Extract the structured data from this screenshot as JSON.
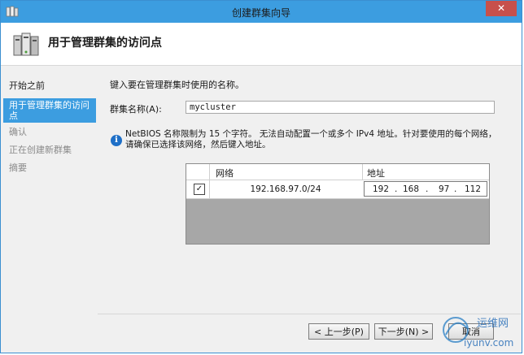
{
  "window": {
    "title": "创建群集向导",
    "close_glyph": "✕"
  },
  "header": {
    "title": "用于管理群集的访问点"
  },
  "sidebar": {
    "items": [
      {
        "label": "开始之前",
        "state": "normal"
      },
      {
        "label": "用于管理群集的访问点",
        "state": "active"
      },
      {
        "label": "确认",
        "state": "muted"
      },
      {
        "label": "正在创建新群集",
        "state": "muted"
      },
      {
        "label": "摘要",
        "state": "muted"
      }
    ]
  },
  "form": {
    "prompt": "键入要在管理群集时使用的名称。",
    "name_label": "群集名称(A):",
    "name_value": "mycluster"
  },
  "info": {
    "icon": "info-icon",
    "text": "NetBIOS 名称限制为 15 个字符。 无法自动配置一个或多个 IPv4 地址。针对要使用的每个网络，请确保已选择该网络，然后键入地址。"
  },
  "network_table": {
    "headers": {
      "network": "网络",
      "address": "地址"
    },
    "rows": [
      {
        "checked": true,
        "check_glyph": "✓",
        "network": "192.168.97.0/24",
        "address": [
          "192",
          "168",
          "97",
          "112"
        ]
      }
    ]
  },
  "buttons": {
    "prev": "< 上一步(P)",
    "next": "下一步(N) >",
    "cancel": "取消"
  },
  "watermark": {
    "line1": "运维网",
    "line2": "iyunv.com"
  },
  "colors": {
    "titlebar": "#3c9de0",
    "selection": "#3c9de0",
    "close": "#c7504b",
    "info_icon": "#1e6fc7"
  }
}
